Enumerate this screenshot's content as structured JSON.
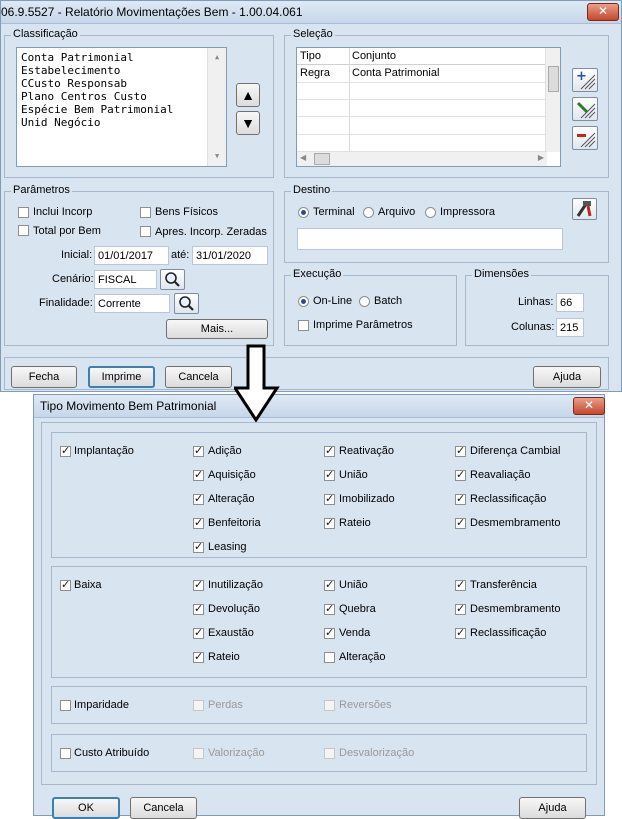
{
  "window1": {
    "title": "06.9.5527 - Relatório Movimentações Bem - 1.00.04.061",
    "close_label": "✕",
    "classificacao": {
      "label": "Classificação",
      "items": [
        "Conta Patrimonial",
        "Estabelecimento",
        "CCusto Responsab",
        "Plano Centros Custo",
        "Espécie Bem Patrimonial",
        "Unid Negócio"
      ],
      "up_label": "▲",
      "down_label": "▼"
    },
    "selecao": {
      "label": "Seleção",
      "columns": [
        "Tipo",
        "Conjunto"
      ],
      "rows": [
        [
          "Regra",
          "Conta Patrimonial"
        ]
      ]
    },
    "parametros": {
      "label": "Parâmetros",
      "checkboxes": [
        {
          "label": "Inclui Incorp",
          "checked": false
        },
        {
          "label": "Bens Físicos",
          "checked": false
        },
        {
          "label": "Total por Bem",
          "checked": false
        },
        {
          "label": "Apres. Incorp. Zeradas",
          "checked": false
        }
      ],
      "inicial_label": "Inicial:",
      "inicial_value": "01/01/2017",
      "ate_label": "até:",
      "ate_value": "31/01/2020",
      "cenario_label": "Cenário:",
      "cenario_value": "FISCAL",
      "finalidade_label": "Finalidade:",
      "finalidade_value": "Corrente",
      "mais_label": "Mais..."
    },
    "destino": {
      "label": "Destino",
      "options": [
        "Terminal",
        "Arquivo",
        "Impressora"
      ],
      "selected": "Terminal",
      "path_value": ""
    },
    "execucao": {
      "label": "Execução",
      "options": [
        "On-Line",
        "Batch"
      ],
      "selected": "On-Line",
      "imprime_parametros": "Imprime Parâmetros"
    },
    "dimensoes": {
      "label": "Dimensões",
      "linhas_label": "Linhas:",
      "linhas_value": "66",
      "colunas_label": "Colunas:",
      "colunas_value": "215"
    },
    "footer": {
      "fecha": "Fecha",
      "imprime": "Imprime",
      "cancela": "Cancela",
      "ajuda": "Ajuda"
    }
  },
  "window2": {
    "title": "Tipo Movimento Bem Patrimonial",
    "close_label": "✕",
    "implantacao": {
      "label": "Implantação",
      "checked": true,
      "items": [
        {
          "label": "Adição",
          "checked": true
        },
        {
          "label": "Reativação",
          "checked": true
        },
        {
          "label": "Diferença Cambial",
          "checked": true
        },
        {
          "label": "Aquisição",
          "checked": true
        },
        {
          "label": "União",
          "checked": true
        },
        {
          "label": "Reavaliação",
          "checked": true
        },
        {
          "label": "Alteração",
          "checked": true
        },
        {
          "label": "Imobilizado",
          "checked": true
        },
        {
          "label": "Reclassificação",
          "checked": true
        },
        {
          "label": "Benfeitoria",
          "checked": true
        },
        {
          "label": "Rateio",
          "checked": true
        },
        {
          "label": "Desmembramento",
          "checked": true
        },
        {
          "label": "Leasing",
          "checked": true
        }
      ]
    },
    "baixa": {
      "label": "Baixa",
      "checked": true,
      "items": [
        {
          "label": "Inutilização",
          "checked": true
        },
        {
          "label": "União",
          "checked": true
        },
        {
          "label": "Transferência",
          "checked": true
        },
        {
          "label": "Devolução",
          "checked": true
        },
        {
          "label": "Quebra",
          "checked": true
        },
        {
          "label": "Desmembramento",
          "checked": true
        },
        {
          "label": "Exaustão",
          "checked": true
        },
        {
          "label": "Venda",
          "checked": true
        },
        {
          "label": "Reclassificação",
          "checked": true
        },
        {
          "label": "Rateio",
          "checked": true
        },
        {
          "label": "Alteração",
          "checked": false
        }
      ]
    },
    "imparidade": {
      "label": "Imparidade",
      "checked": false,
      "items": [
        {
          "label": "Perdas"
        },
        {
          "label": "Reversões"
        }
      ]
    },
    "custo": {
      "label": "Custo Atribuído",
      "checked": false,
      "items": [
        {
          "label": "Valorização"
        },
        {
          "label": "Desvalorização"
        }
      ]
    },
    "footer": {
      "ok": "OK",
      "cancela": "Cancela",
      "ajuda": "Ajuda"
    }
  }
}
